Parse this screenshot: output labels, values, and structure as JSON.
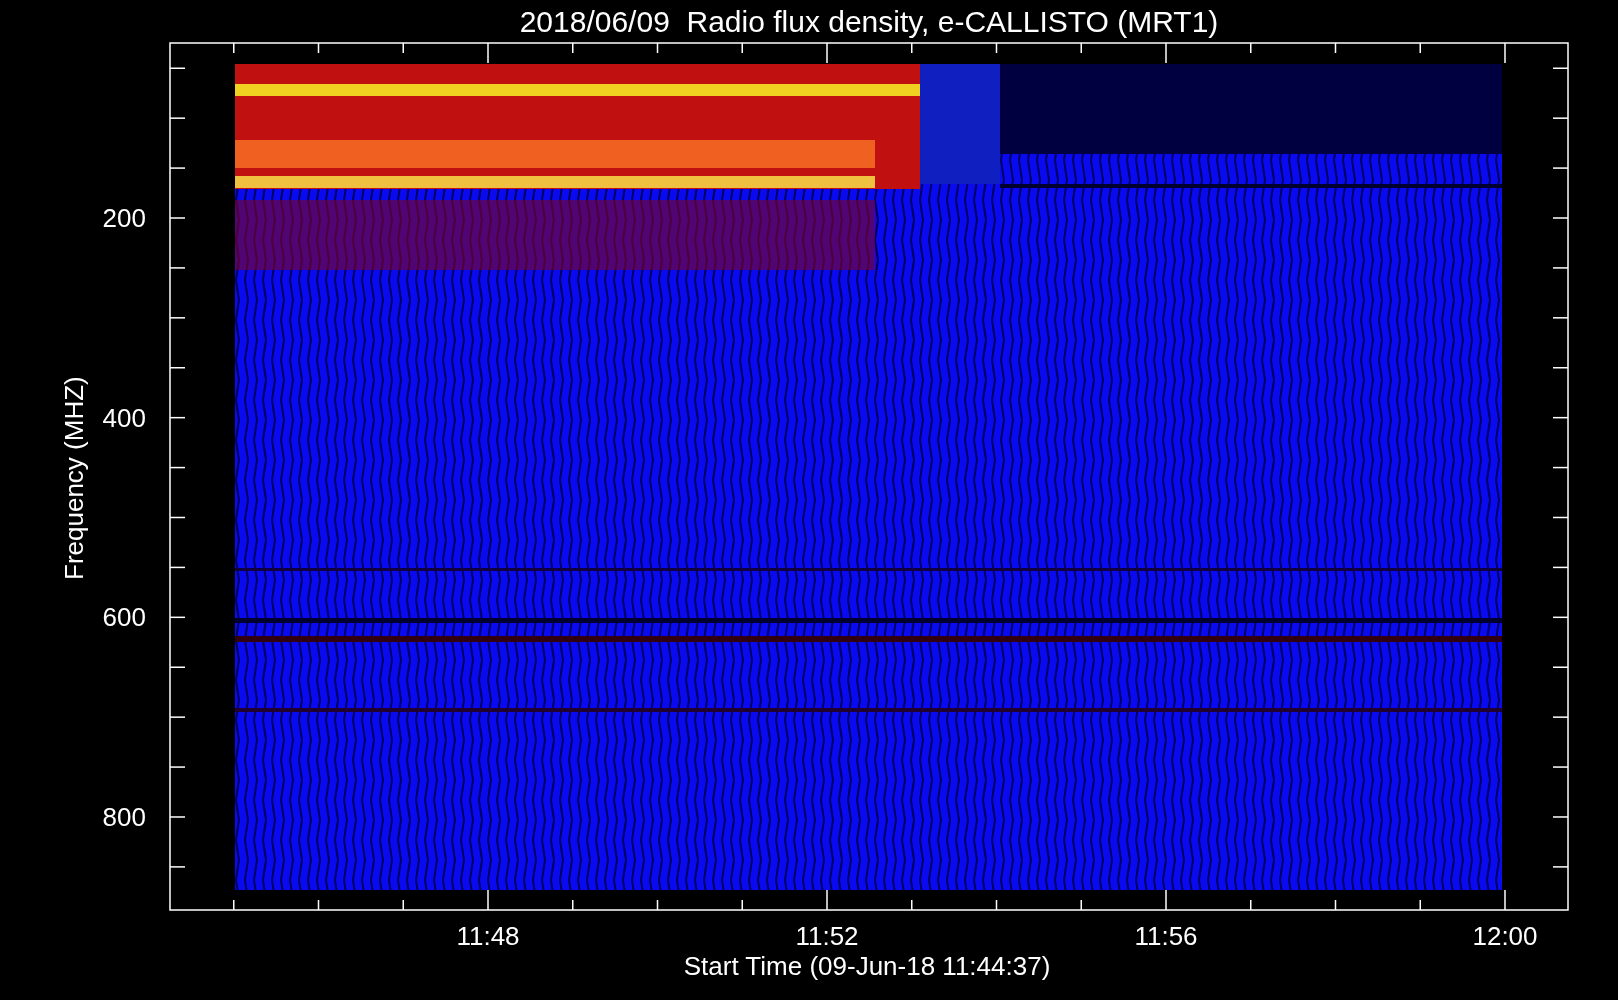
{
  "title": "2018/06/09  Radio flux density, e-CALLISTO (MRT1)",
  "y_axis": {
    "label": "Frequency (MHZ)",
    "tick_labels": [
      "200",
      "400",
      "600",
      "800"
    ]
  },
  "x_axis": {
    "label": "Start Time (09-Jun-18 11:44:37)",
    "tick_labels": [
      "11:48",
      "11:52",
      "11:56",
      "12:00"
    ]
  }
}
